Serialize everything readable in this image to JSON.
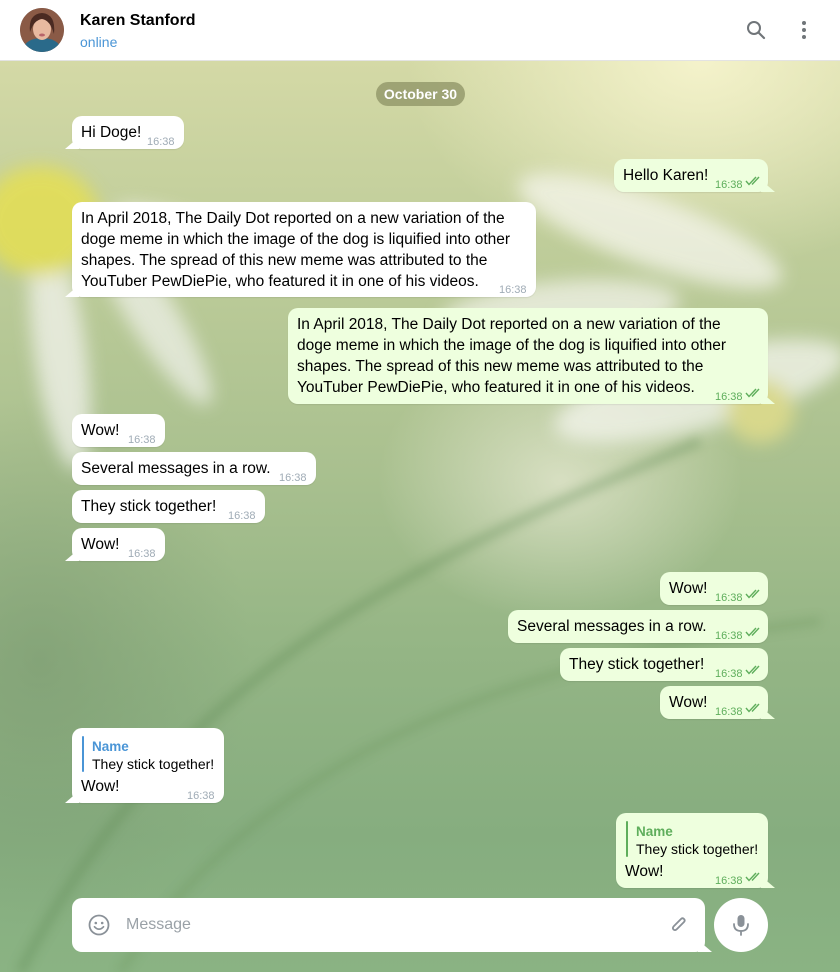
{
  "header": {
    "contact_name": "Karen Stanford",
    "status": "online",
    "icons": [
      "search-icon",
      "more-vertical-icon"
    ]
  },
  "chat": {
    "date_label": "October 30",
    "messages": [
      {
        "dir": "in",
        "text": "Hi Doge!",
        "time": "16:38"
      },
      {
        "dir": "out",
        "text": "Hello Karen!",
        "time": "16:38",
        "read": true
      },
      {
        "dir": "in",
        "text": "In April 2018, The Daily Dot reported on a new variation of the\ndoge meme in which the image of the dog is liquified into other\nshapes. The spread of this new meme was attributed to the\nYouTuber PewDiePie, who featured it in one of his videos.",
        "time": "16:38"
      },
      {
        "dir": "out",
        "text": "In April 2018, The Daily Dot reported on a new variation of the\ndoge meme in which the image of the dog is liquified into other\nshapes. The spread of this new meme was attributed to the\nYouTuber PewDiePie, who featured it in one of his videos.",
        "time": "16:38",
        "read": true
      },
      {
        "dir": "in",
        "text": "Wow!",
        "time": "16:38"
      },
      {
        "dir": "in",
        "text": "Several messages in a row.",
        "time": "16:38"
      },
      {
        "dir": "in",
        "text": "They stick together!",
        "time": "16:38"
      },
      {
        "dir": "in",
        "text": "Wow!",
        "time": "16:38"
      },
      {
        "dir": "out",
        "text": "Wow!",
        "time": "16:38",
        "read": true
      },
      {
        "dir": "out",
        "text": "Several messages in a row.",
        "time": "16:38",
        "read": true
      },
      {
        "dir": "out",
        "text": "They stick together!",
        "time": "16:38",
        "read": true
      },
      {
        "dir": "out",
        "text": "Wow!",
        "time": "16:38",
        "read": true
      },
      {
        "dir": "in",
        "reply_name": "Name",
        "reply_text": "They stick together!",
        "text": "Wow!",
        "time": "16:38"
      },
      {
        "dir": "out",
        "reply_name": "Name",
        "reply_text": "They stick together!",
        "text": "Wow!",
        "time": "16:38",
        "read": true
      }
    ]
  },
  "composer": {
    "placeholder": "Message",
    "value": "",
    "icons": [
      "emoji-icon",
      "attach-icon",
      "microphone-icon"
    ]
  },
  "colors": {
    "incoming_bubble": "#ffffff",
    "outgoing_bubble": "#eeffde",
    "time_in": "#a0acb6",
    "time_out": "#5fae5c",
    "accent_blue": "#4a95d6",
    "reply_name_in": "#4a95d6",
    "reply_name_out": "#5fae5c",
    "date_pill": "#8c9164"
  }
}
